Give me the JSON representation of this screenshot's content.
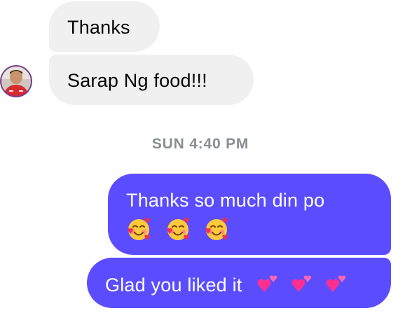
{
  "conversation": {
    "messages": [
      {
        "sender": "contact",
        "text": "Thanks"
      },
      {
        "sender": "contact",
        "text": "Sarap Ng food!!!"
      }
    ],
    "timestamp": "SUN 4:40 PM",
    "replies": [
      {
        "sender": "me",
        "text": "Thanks so much din po",
        "emoji": [
          "smiling-face-with-hearts",
          "smiling-face-with-hearts",
          "smiling-face-with-hearts"
        ]
      },
      {
        "sender": "me",
        "text": "Glad you liked it",
        "emoji": [
          "two-hearts",
          "two-hearts",
          "two-hearts"
        ]
      }
    ]
  },
  "colors": {
    "incoming_bubble": "#f0f0f0",
    "outgoing_bubble": "#5b4dff",
    "timestamp_text": "#8a8d91"
  }
}
